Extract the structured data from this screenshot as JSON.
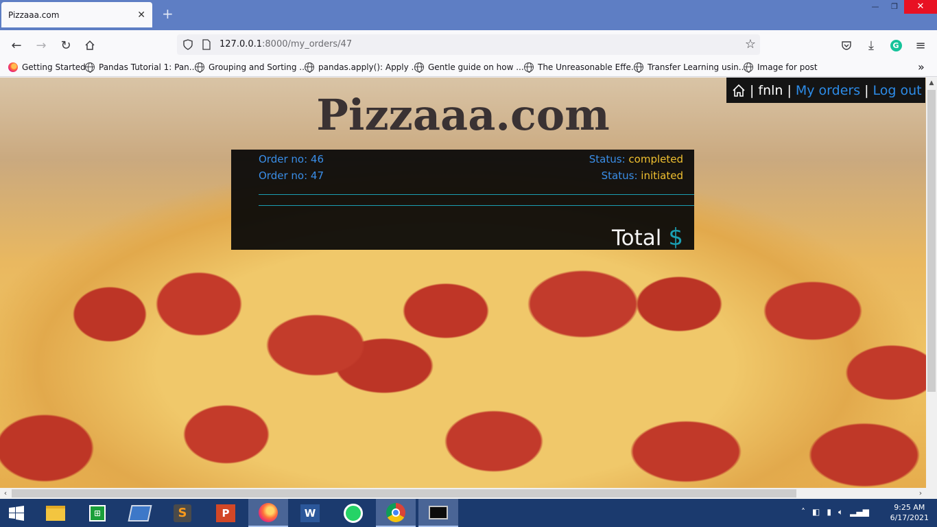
{
  "browser": {
    "tab_title": "Pizzaaa.com",
    "url_host": "127.0.0.1",
    "url_rest": ":8000/my_orders/47",
    "bookmarks": [
      "Getting Started",
      "Pandas Tutorial 1: Pan...",
      "Grouping and Sorting ...",
      "pandas.apply(): Apply ...",
      "Gentle guide on how ...",
      "The Unreasonable Effe...",
      "Transfer Learning usin...",
      "Image for post"
    ]
  },
  "site": {
    "title": "Pizzaaa.com",
    "nav": {
      "username": "fnln",
      "my_orders": "My orders",
      "logout": "Log out",
      "separator": "|"
    },
    "orders": [
      {
        "order_label": "Order no: 46",
        "status_label": "Status:",
        "status_value": "completed"
      },
      {
        "order_label": "Order no: 47",
        "status_label": "Status:",
        "status_value": "initiated"
      }
    ],
    "total_label": "Total",
    "currency": "$"
  },
  "taskbar": {
    "time": "9:25 AM",
    "date": "6/17/2021",
    "apps": [
      "file-explorer",
      "store",
      "media",
      "sublime-text",
      "powerpoint",
      "firefox",
      "word",
      "whatsapp",
      "chrome",
      "terminal"
    ]
  }
}
